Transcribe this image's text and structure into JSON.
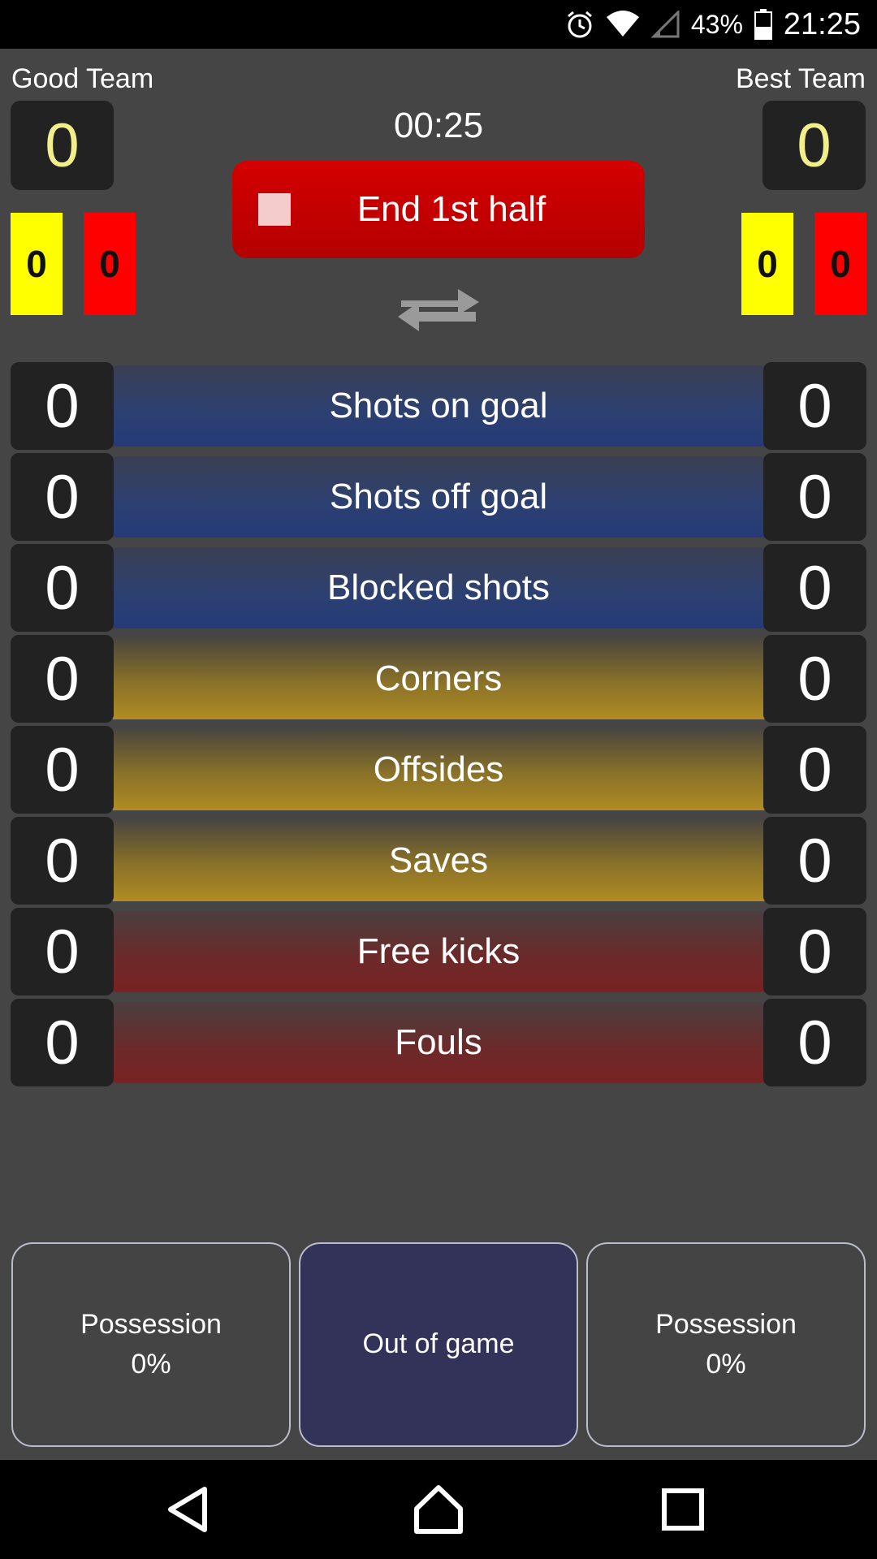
{
  "status_bar": {
    "battery": "43%",
    "time": "21:25",
    "icons": [
      "alarm-icon",
      "wifi-icon",
      "signal-icon",
      "battery-icon"
    ]
  },
  "home_team": {
    "name": "Good Team",
    "score": "0",
    "yellow_cards": "0",
    "red_cards": "0"
  },
  "away_team": {
    "name": "Best Team",
    "score": "0",
    "yellow_cards": "0",
    "red_cards": "0"
  },
  "timer": "00:25",
  "end_half_button": "End 1st half",
  "stats": [
    {
      "label": "Shots on goal",
      "home": "0",
      "away": "0",
      "color": "blue"
    },
    {
      "label": "Shots off goal",
      "home": "0",
      "away": "0",
      "color": "blue"
    },
    {
      "label": "Blocked shots",
      "home": "0",
      "away": "0",
      "color": "blue"
    },
    {
      "label": "Corners",
      "home": "0",
      "away": "0",
      "color": "gold"
    },
    {
      "label": "Offsides",
      "home": "0",
      "away": "0",
      "color": "gold"
    },
    {
      "label": "Saves",
      "home": "0",
      "away": "0",
      "color": "gold"
    },
    {
      "label": "Free kicks",
      "home": "0",
      "away": "0",
      "color": "maroon"
    },
    {
      "label": "Fouls",
      "home": "0",
      "away": "0",
      "color": "maroon"
    }
  ],
  "possession": {
    "home_label": "Possession",
    "home_value": "0%",
    "middle_label": "Out of game",
    "away_label": "Possession",
    "away_value": "0%"
  },
  "nav": {
    "icons": [
      "back-icon",
      "home-icon",
      "recents-icon"
    ]
  },
  "colors": {
    "score": "#f2ee8c",
    "yellow_card": "#ffff00",
    "red_card": "#ff0000",
    "end_button": "#c40000"
  }
}
